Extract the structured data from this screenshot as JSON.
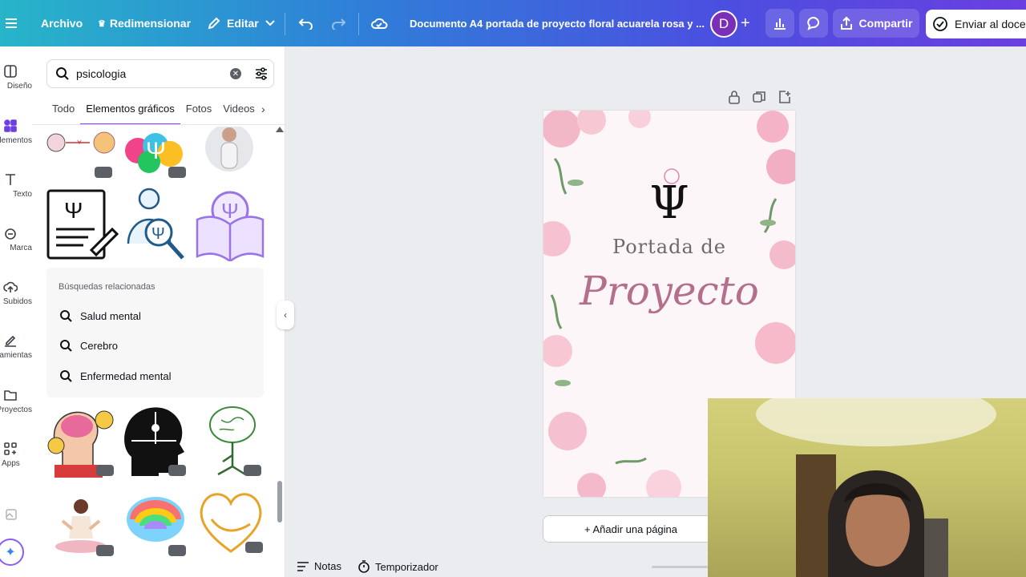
{
  "topbar": {
    "menu_icon": "hamburger-icon",
    "archivo": "Archivo",
    "redimensionar": "Redimensionar",
    "editar": "Editar",
    "doc_title": "Documento A4 portada de proyecto floral acuarela rosa y ...",
    "avatar_letter": "D",
    "compartir": "Compartir",
    "enviar": "Enviar al docen"
  },
  "rail": {
    "items": [
      {
        "label": "Diseño",
        "icon": "layout-icon"
      },
      {
        "label": "Elementos",
        "icon": "shapes-icon"
      },
      {
        "label": "Texto",
        "icon": "text-icon"
      },
      {
        "label": "Marca",
        "icon": "brand-icon"
      },
      {
        "label": "Subidos",
        "icon": "upload-icon"
      },
      {
        "label": "Herramientas",
        "icon": "draw-icon"
      },
      {
        "label": "Proyectos",
        "icon": "folder-icon"
      },
      {
        "label": "Apps",
        "icon": "apps-icon"
      }
    ]
  },
  "panel": {
    "search_value": "psicologia",
    "tabs": [
      "Todo",
      "Elementos gráficos",
      "Fotos",
      "Videos"
    ],
    "active_tab": "Elementos gráficos",
    "related_header": "Búsquedas relacionadas",
    "related": [
      "Salud mental",
      "Cerebro",
      "Enfermedad mental"
    ]
  },
  "canvas": {
    "title_line1": "Portada de",
    "title_line2": "Proyecto",
    "symbol": "Ψ",
    "add_page": "+ Añadir una página"
  },
  "bottom": {
    "notas": "Notas",
    "temporizador": "Temporizador"
  },
  "colors": {
    "accent": "#8b3dff",
    "avatar": "#7b2fb8",
    "title_pink": "#b46f8c"
  }
}
